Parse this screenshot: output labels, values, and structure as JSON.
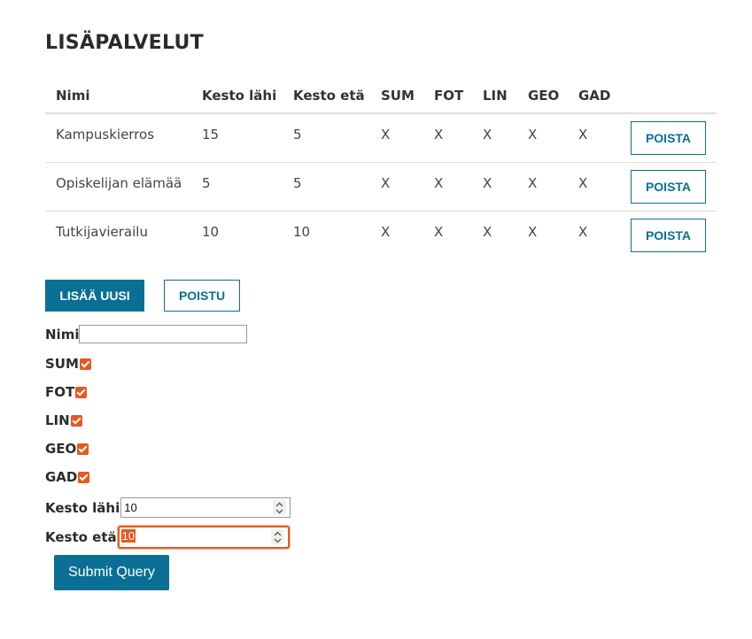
{
  "page": {
    "title": "LISÄPALVELUT"
  },
  "table": {
    "headers": {
      "name": "Nimi",
      "duration_near": "Kesto lähi",
      "duration_far": "Kesto etä",
      "sum": "SUM",
      "fot": "FOT",
      "lin": "LIN",
      "geo": "GEO",
      "gad": "GAD"
    },
    "rows": [
      {
        "name": "Kampuskierros",
        "duration_near": "15",
        "duration_far": "5",
        "sum": "X",
        "fot": "X",
        "lin": "X",
        "geo": "X",
        "gad": "X",
        "delete_label": "POISTA"
      },
      {
        "name": "Opiskelijan elämää",
        "duration_near": "5",
        "duration_far": "5",
        "sum": "X",
        "fot": "X",
        "lin": "X",
        "geo": "X",
        "gad": "X",
        "delete_label": "POISTA"
      },
      {
        "name": "Tutkijavierailu",
        "duration_near": "10",
        "duration_far": "10",
        "sum": "X",
        "fot": "X",
        "lin": "X",
        "geo": "X",
        "gad": "X",
        "delete_label": "POISTA"
      }
    ]
  },
  "actions": {
    "add_new_label": "LISÄÄ UUSI",
    "exit_label": "POISTU"
  },
  "form": {
    "name_label": "Nimi",
    "name_value": "",
    "checkboxes": [
      {
        "label": "SUM",
        "checked": true
      },
      {
        "label": "FOT",
        "checked": true
      },
      {
        "label": "LIN",
        "checked": true
      },
      {
        "label": "GEO",
        "checked": true
      },
      {
        "label": "GAD",
        "checked": true
      }
    ],
    "duration_near_label": "Kesto lähi",
    "duration_near_value": "10",
    "duration_far_label": "Kesto etä",
    "duration_far_value": "10",
    "submit_label": "Submit Query"
  },
  "colors": {
    "primary": "#0a6f94",
    "checkbox_accent": "#e8581e",
    "focus_ring": "#e8581e"
  },
  "icons": {
    "spinner": "spinner-up-down-icon",
    "checkbox": "checkmark-icon"
  }
}
